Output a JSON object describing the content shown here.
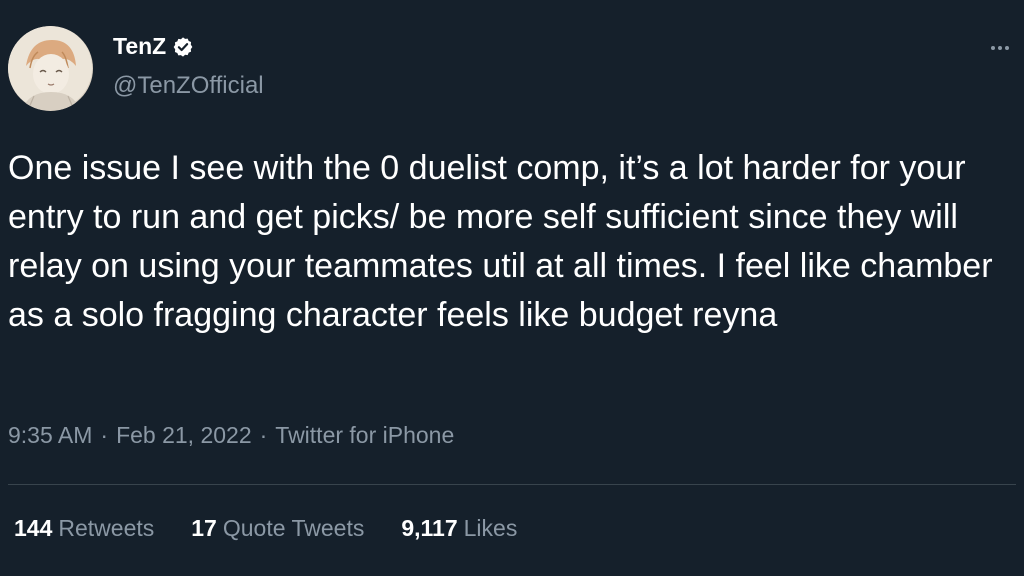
{
  "author": {
    "name": "TenZ",
    "handle": "@TenZOfficial",
    "verified_icon": "verified-badge-icon",
    "avatar": "avatar"
  },
  "more_icon": "more-options-icon",
  "tweet": {
    "text": "One issue I see with the 0 duelist comp, it’s a lot harder for your entry to run and get picks/ be more self sufficient since they will relay on using your teammates util at all times. I feel like chamber as a solo fragging character feels like budget reyna"
  },
  "meta": {
    "time": "9:35 AM",
    "sep1": "·",
    "date": "Feb 21, 2022",
    "sep2": "·",
    "source": "Twitter for iPhone"
  },
  "stats": {
    "retweets": {
      "count": "144",
      "label": "Retweets"
    },
    "quotes": {
      "count": "17",
      "label": "Quote Tweets"
    },
    "likes": {
      "count": "9,117",
      "label": "Likes"
    }
  },
  "colors": {
    "background": "#15202b",
    "text": "#ffffff",
    "secondary": "#8b98a5",
    "divider": "#38444d",
    "verified_badge": "#ffffff"
  }
}
